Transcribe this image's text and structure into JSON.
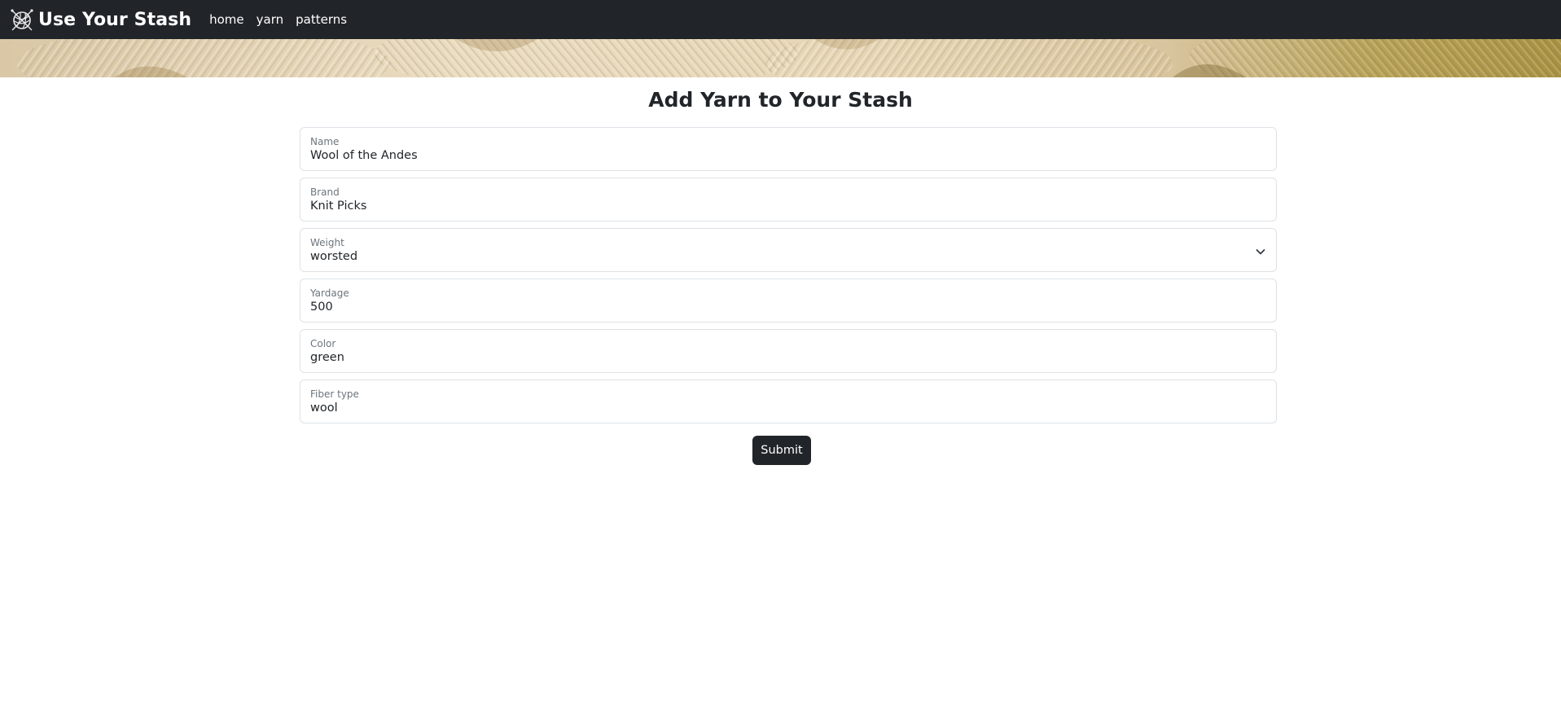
{
  "navbar": {
    "brand": {
      "title": "Use Your Stash",
      "icon": "yarn-ball-icon"
    },
    "links": [
      {
        "label": "home"
      },
      {
        "label": "yarn"
      },
      {
        "label": "patterns"
      }
    ],
    "background_color": "#212529"
  },
  "banner": {
    "image": "yarn-skeins-banner"
  },
  "page": {
    "title": "Add Yarn to Your Stash"
  },
  "form": {
    "fields": [
      {
        "label": "Name",
        "value": "Wool of the Andes",
        "type": "text"
      },
      {
        "label": "Brand",
        "value": "Knit Picks",
        "type": "text"
      },
      {
        "label": "Weight",
        "value": "worsted",
        "type": "select",
        "icon": "chevron-down-icon"
      },
      {
        "label": "Yardage",
        "value": "500",
        "type": "number"
      },
      {
        "label": "Color",
        "value": "green",
        "type": "text"
      },
      {
        "label": "Fiber type",
        "value": "wool",
        "type": "text"
      }
    ],
    "submit_label": "Submit"
  },
  "colors": {
    "primary_dark": "#212529",
    "border": "#dee2e6",
    "label_gray": "#6c757d"
  }
}
